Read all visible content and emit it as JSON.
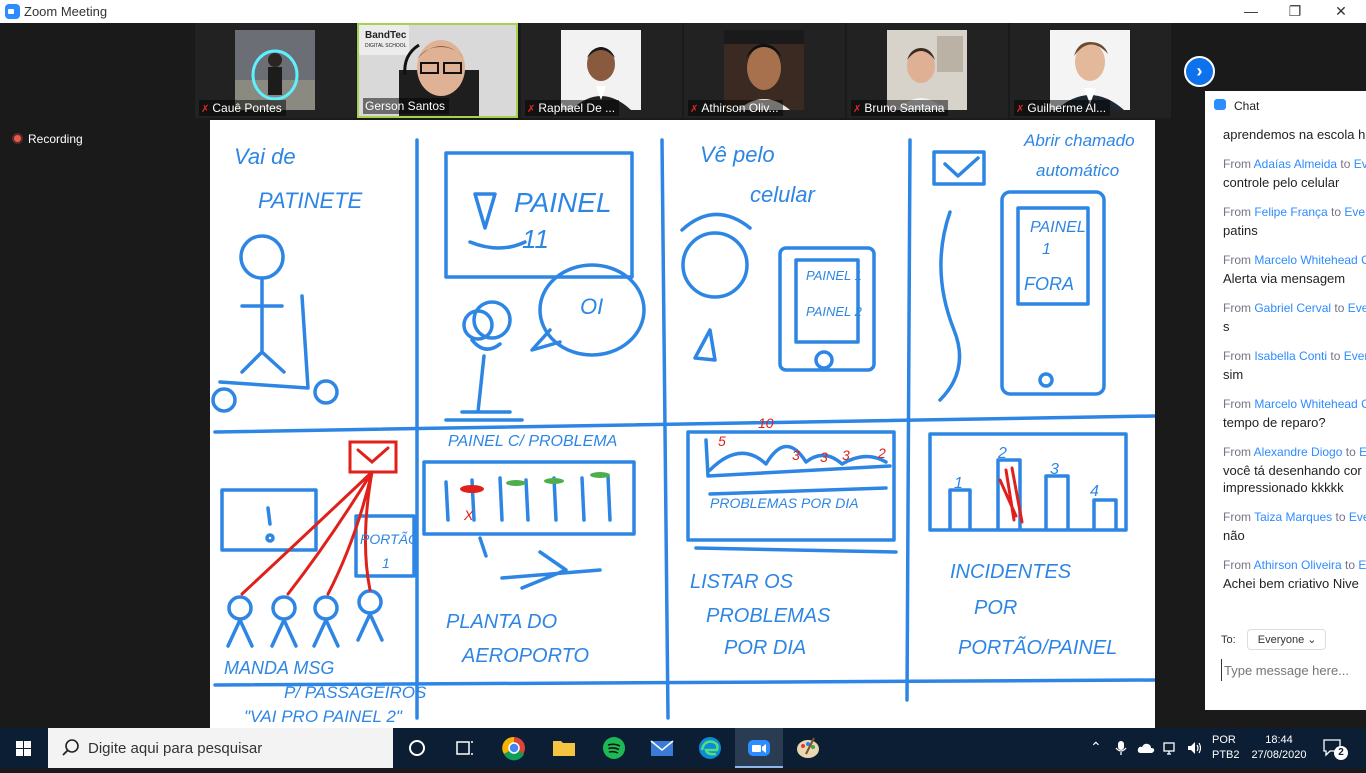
{
  "window": {
    "title": "Zoom Meeting"
  },
  "participants": [
    {
      "name": "Cauê Pontes",
      "muted": true,
      "active": false
    },
    {
      "name": "Gerson Santos",
      "muted": false,
      "active": true
    },
    {
      "name": "Raphael De ...",
      "muted": true,
      "active": false
    },
    {
      "name": "Athirson Oliv...",
      "muted": true,
      "active": false
    },
    {
      "name": "Bruno Santana",
      "muted": true,
      "active": false
    },
    {
      "name": "Guilherme Al...",
      "muted": true,
      "active": false
    }
  ],
  "tile_logo": {
    "line1": "BandTec",
    "line2": "DIGITAL SCHOOL"
  },
  "recording": {
    "label": "Recording"
  },
  "board": {
    "t1": "Vai de",
    "t2": "PATINETE",
    "t3": "PAINEL",
    "t4": "11",
    "t5": "!",
    "t6": "Vê pelo",
    "t7": "celular",
    "t8": "PAINEL 1",
    "t9": "PAINEL 2",
    "t10": "Abrir chamado",
    "t11": "automático",
    "t12": "PAINEL",
    "t13": "1",
    "t14": "FORA",
    "t15": "OI",
    "t16": "PAINEL C/ PROBLEMA",
    "t17": "PORTÃO",
    "t18": "1",
    "t19": "MANDA MSG",
    "t20": "P/ PASSAGEIROS",
    "t21": "\"VAI PRO PAINEL 2\"",
    "t22": "PLANTA DO",
    "t23": "AEROPORTO",
    "t24": "PROBLEMAS POR DIA",
    "t25": "LISTAR OS",
    "t26": "PROBLEMAS",
    "t27": "POR DIA",
    "t28": "INCIDENTES",
    "t29": "POR",
    "t30": "PORTÃO/PAINEL",
    "n1": "5",
    "n2": "10",
    "n3": "3",
    "n4": "3",
    "n5": "3",
    "n6": "2",
    "b1": "1",
    "b2": "2",
    "b3": "3",
    "b4": "4",
    "x": "X",
    "q": "?"
  },
  "chat": {
    "title": "Chat",
    "messages": [
      {
        "from": "",
        "to": "",
        "text": "aprendemos na escola h"
      },
      {
        "from": "Adaías Almeida",
        "to": "Eve",
        "text": "controle pelo celular"
      },
      {
        "from": "Felipe França",
        "to": "Every",
        "text": "patins"
      },
      {
        "from": "Marcelo Whitehead",
        "to": "C",
        "text": "Alerta via mensagem"
      },
      {
        "from": "Gabriel Cerval",
        "to": "Ever",
        "text": "s"
      },
      {
        "from": "Isabella Conti",
        "to": "Every",
        "text": "sim"
      },
      {
        "from": "Marcelo Whitehead",
        "to": "C",
        "text": "tempo de reparo?"
      },
      {
        "from": "Alexandre Diogo",
        "to": "E",
        "text": "você tá desenhando cor\nimpressionado kkkkk"
      },
      {
        "from": "Taiza Marques",
        "to": "Ever",
        "text": "não"
      },
      {
        "from": "Athirson Oliveira",
        "to": "E",
        "text": "Achei bem criativo Nive"
      }
    ],
    "to_label": "To:",
    "to_value": "Everyone",
    "input_placeholder": "Type message here..."
  },
  "taskbar": {
    "search_placeholder": "Digite aqui para pesquisar",
    "lang1": "POR",
    "lang2": "PTB2",
    "time": "18:44",
    "date": "27/08/2020",
    "notifications": "2"
  }
}
